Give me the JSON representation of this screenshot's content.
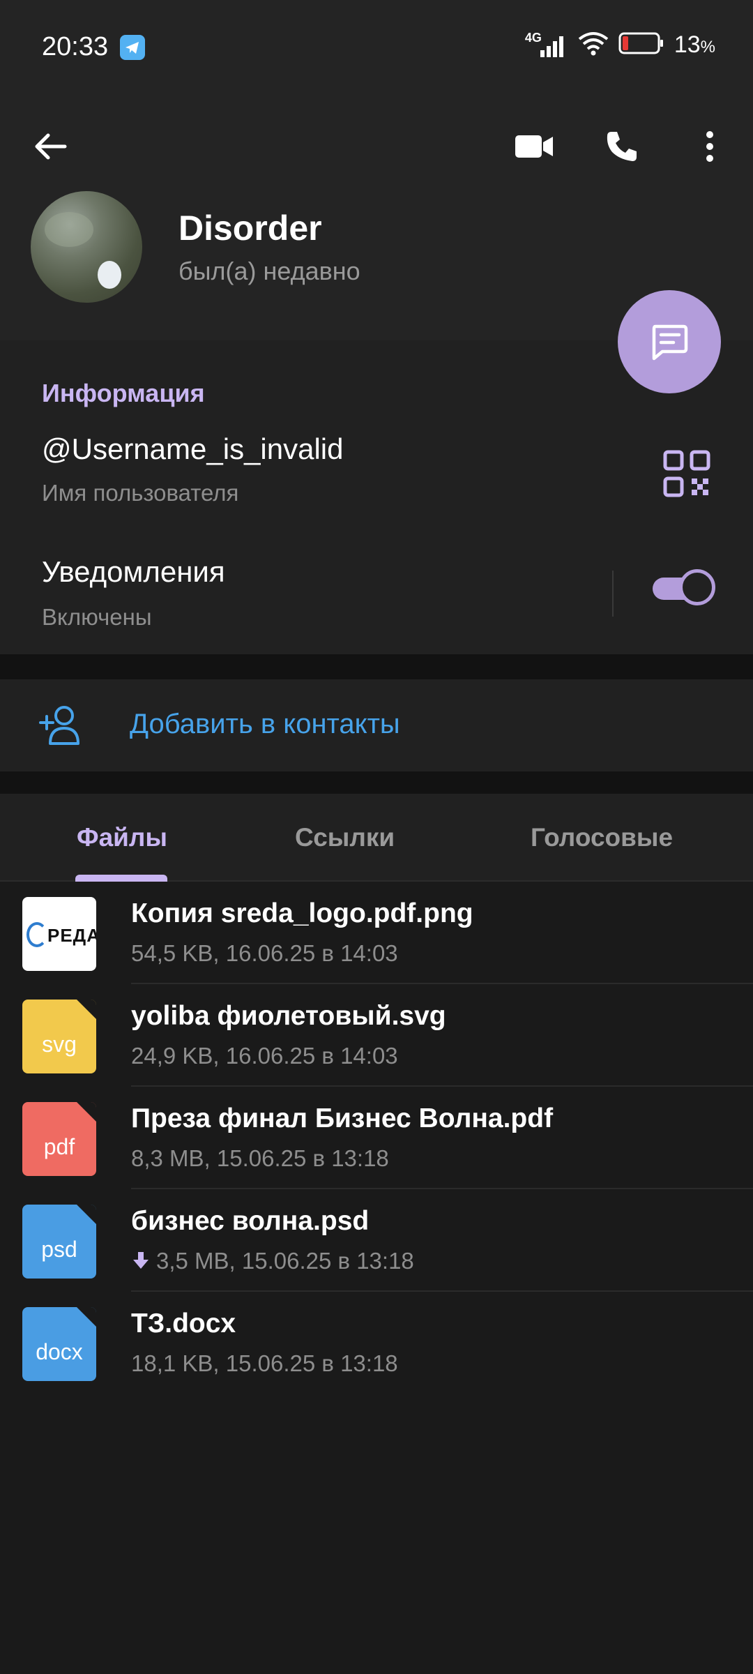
{
  "status_bar": {
    "time": "20:33",
    "network": "4G",
    "battery": "13",
    "battery_unit": "%",
    "icons": [
      "telegram-icon",
      "signal-icon",
      "wifi-icon",
      "battery-icon"
    ]
  },
  "header": {
    "name": "Disorder",
    "status": "был(а) недавно",
    "icons": [
      "back-arrow-icon",
      "video-call-icon",
      "phone-icon",
      "more-vert-icon",
      "message-icon"
    ]
  },
  "info": {
    "title": "Информация",
    "username": "@Username_is_invalid",
    "username_label": "Имя пользователя",
    "notifications": "Уведомления",
    "notifications_state": "Включены",
    "notifications_enabled": true
  },
  "add_contact": {
    "label": "Добавить в контакты"
  },
  "tabs": [
    {
      "label": "Файлы",
      "active": true
    },
    {
      "label": "Ссылки",
      "active": false
    },
    {
      "label": "Голосовые",
      "active": false
    }
  ],
  "files": [
    {
      "name": "Копия sreda_logo.pdf.png",
      "meta": "54,5 KB, 16.06.25 в 14:03",
      "type": "image",
      "thumb_text": "РЕДА"
    },
    {
      "name": "yoliba фиолетовый.svg",
      "meta": "24,9 KB, 16.06.25 в 14:03",
      "type": "svg",
      "ext": "svg"
    },
    {
      "name": "Преза финал Бизнес Волна.pdf",
      "meta": "8,3 MB, 15.06.25 в 13:18",
      "type": "pdf",
      "ext": "pdf"
    },
    {
      "name": "бизнес волна.psd",
      "meta": "3,5 MB, 15.06.25 в 13:18",
      "type": "psd",
      "ext": "psd",
      "downloading": true
    },
    {
      "name": "ТЗ.docx",
      "meta": "18,1 KB, 15.06.25 в 13:18",
      "type": "docx",
      "ext": "docx"
    }
  ],
  "colors": {
    "accent": "#c9b6f2",
    "fab": "#b39ddb",
    "link": "#47a3ea",
    "svg_icon": "#f2c94c",
    "pdf_icon": "#ef6b62",
    "psd_icon": "#4a9de3",
    "docx_icon": "#4a9de3"
  }
}
